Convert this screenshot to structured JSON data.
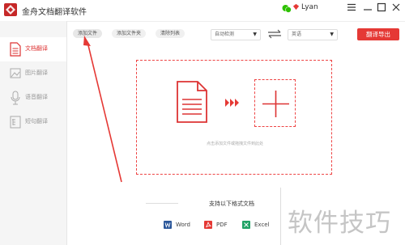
{
  "app": {
    "title": "金舟文档翻译软件",
    "user": "Lyan"
  },
  "sidebar": {
    "items": [
      {
        "label": "文档翻译",
        "icon": "document-icon",
        "active": true
      },
      {
        "label": "图片翻译",
        "icon": "image-icon",
        "active": false
      },
      {
        "label": "语音翻译",
        "icon": "microphone-icon",
        "active": false
      },
      {
        "label": "短句翻译",
        "icon": "text-icon",
        "active": false
      }
    ]
  },
  "toolbar": {
    "add_file": "添加文件",
    "add_folder": "添加文件夹",
    "clear_list": "清除列表",
    "source_lang": "自动检测",
    "target_lang": "英语",
    "export": "翻译导出"
  },
  "dropzone": {
    "hint": "点击添加文件或拖拽文件到此处"
  },
  "formats": {
    "title": "支持以下格式文档",
    "items": [
      {
        "label": "Word",
        "icon": "word-icon",
        "color": "#2b579a"
      },
      {
        "label": "PDF",
        "icon": "pdf-icon",
        "color": "#e53935"
      },
      {
        "label": "Excel",
        "icon": "excel-icon",
        "color": "#21a366"
      }
    ]
  },
  "watermark": "软件技巧",
  "colors": {
    "accent": "#e53935",
    "sidebar_bg": "#f5f5f5"
  }
}
